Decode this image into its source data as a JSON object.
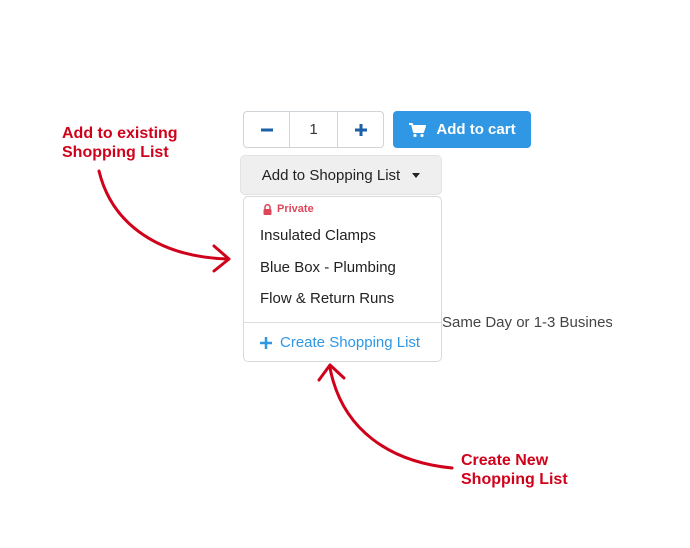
{
  "quantity": {
    "value": "1",
    "decrement_icon": "minus-icon",
    "increment_icon": "plus-icon"
  },
  "cart_button": {
    "label": "Add to cart",
    "icon": "cart-icon",
    "color": "#2f97e4"
  },
  "shopping_list_toggle": {
    "label": "Add to Shopping List",
    "icon": "caret-down-icon"
  },
  "dropdown": {
    "section_label": "Private",
    "section_icon": "lock-icon",
    "items": [
      {
        "label": "Insulated Clamps"
      },
      {
        "label": "Blue Box - Plumbing"
      },
      {
        "label": "Flow & Return Runs"
      }
    ],
    "create_label": "Create Shopping List",
    "create_icon": "plus-icon"
  },
  "delivery_text": "Same Day or 1-3 Business",
  "annotations": {
    "existing_line1": "Add to existing",
    "existing_line2": "Shopping List",
    "create_line1": "Create New",
    "create_line2": "Shopping List",
    "color": "#d0021b"
  }
}
